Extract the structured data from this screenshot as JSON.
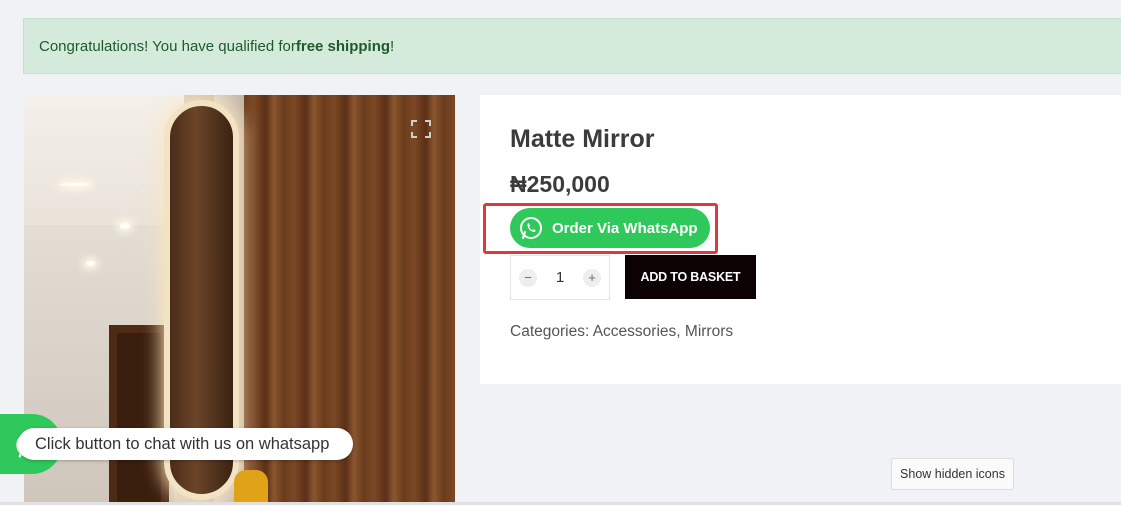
{
  "notice": {
    "prefix": "Congratulations! You have qualified for ",
    "bold": "free shipping",
    "suffix": "!"
  },
  "product": {
    "title": "Matte Mirror",
    "price": "₦250,000",
    "whatsapp_button": "Order Via WhatsApp",
    "quantity": "1",
    "qty_minus": "−",
    "qty_plus": "+",
    "add_to_basket": "ADD TO BASKET",
    "categories_label": "Categories: ",
    "categories": [
      "Accessories",
      "Mirrors"
    ],
    "category_separator": ", "
  },
  "chat": {
    "prompt": "Click button to chat with us on whatsapp"
  },
  "system": {
    "show_hidden_icons": "Show hidden icons"
  },
  "colors": {
    "whatsapp_green": "#2fc85a",
    "highlight_red": "#e0383b",
    "notice_bg": "#d4ebdb",
    "basket_button": "#0c0204"
  },
  "icons": {
    "whatsapp": "whatsapp-icon",
    "expand": "expand-icon"
  }
}
